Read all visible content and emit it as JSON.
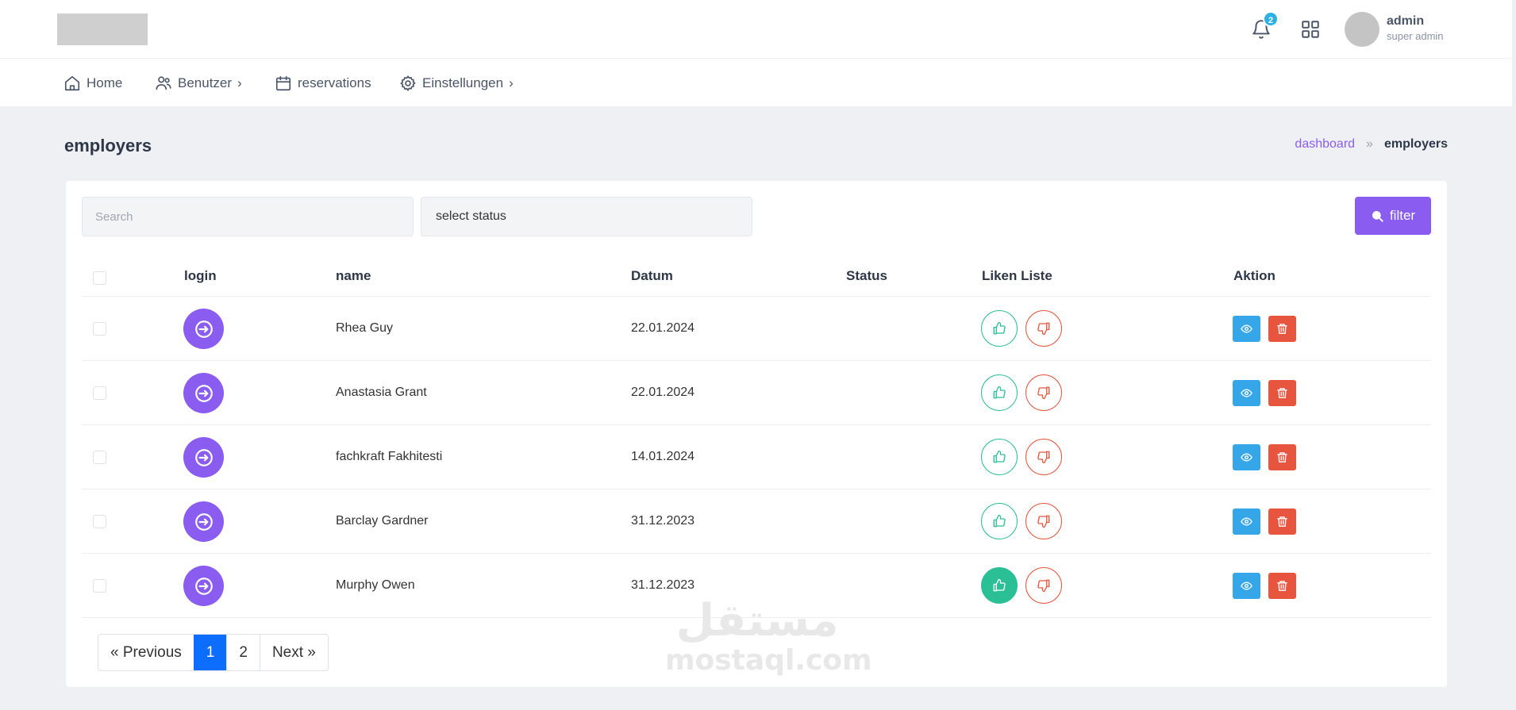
{
  "header": {
    "notifications_count": "2",
    "user": {
      "name": "admin",
      "role": "super admin"
    }
  },
  "nav": {
    "home": "Home",
    "users": "Benutzer",
    "reservations": "reservations",
    "settings": "Einstellungen"
  },
  "page": {
    "title": "employers",
    "breadcrumb": {
      "parent": "dashboard",
      "current": "employers"
    }
  },
  "filters": {
    "search_placeholder": "Search",
    "status_select": "select status",
    "filter_label": "filter"
  },
  "table": {
    "columns": [
      "login",
      "name",
      "Datum",
      "Status",
      "Liken Liste",
      "Aktion"
    ],
    "rows": [
      {
        "name": "Rhea Guy",
        "date": "22.01.2024",
        "liked": false
      },
      {
        "name": "Anastasia Grant",
        "date": "22.01.2024",
        "liked": false
      },
      {
        "name": "fachkraft Fakhitesti",
        "date": "14.01.2024",
        "liked": false
      },
      {
        "name": "Barclay Gardner",
        "date": "31.12.2023",
        "liked": false
      },
      {
        "name": "Murphy Owen",
        "date": "31.12.2023",
        "liked": true
      }
    ]
  },
  "pagination": {
    "previous": "« Previous",
    "pages": [
      "1",
      "2"
    ],
    "active_page": "1",
    "next": "Next »"
  },
  "watermark": {
    "arabic": "مستقل",
    "latin": "mostaql.com"
  },
  "colors": {
    "primary": "#8a5cf0",
    "like": "#2bbf96",
    "dislike": "#e8553e",
    "view": "#35a7e8",
    "page_active": "#0d6efd"
  }
}
